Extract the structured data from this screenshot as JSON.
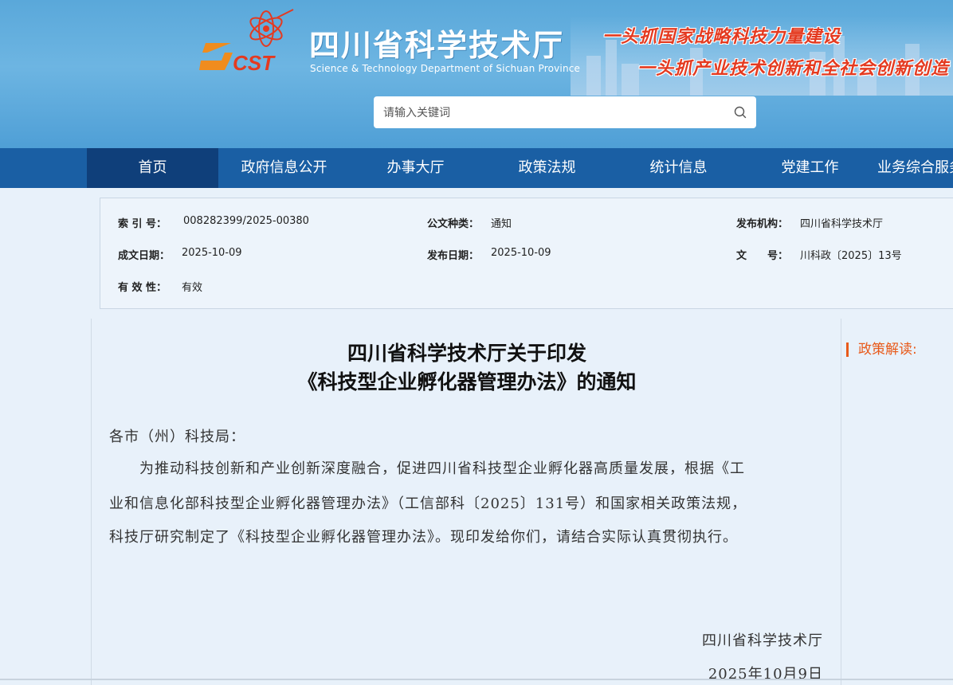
{
  "header": {
    "site_title": "四川省科学技术厅",
    "site_subtitle": "Science & Technology Department of Sichuan Province",
    "logo_text": "SCST",
    "slogan_line1": "一头抓国家战略科技力量建设",
    "slogan_line2": "一头抓产业技术创新和全社会创新创造",
    "search_placeholder": "请输入关键词"
  },
  "nav": {
    "items": [
      "首页",
      "政府信息公开",
      "办事大厅",
      "政策法规",
      "统计信息",
      "党建工作",
      "业务综合服务"
    ],
    "active_index": 0
  },
  "meta": {
    "index_label": "索 引 号：",
    "index_value": "008282399/2025-00380",
    "doc_type_label": "公文种类：",
    "doc_type_value": "通知",
    "publisher_label": "发布机构：",
    "publisher_value": "四川省科学技术厅",
    "written_date_label": "成文日期：",
    "written_date_value": "2025-10-09",
    "publish_date_label": "发布日期：",
    "publish_date_value": "2025-10-09",
    "doc_no_label": "文　　号：",
    "doc_no_value": "川科政〔2025〕13号",
    "validity_label": "有 效 性：",
    "validity_value": "有效"
  },
  "article": {
    "title_line1": "四川省科学技术厅关于印发",
    "title_line2": "《科技型企业孵化器管理办法》的通知",
    "salutation": "各市（州）科技局：",
    "body_line1": "　　为推动科技创新和产业创新深度融合，促进四川省科技型企业孵化器高质量发展，根据《工",
    "body_line2": "业和信息化部科技型企业孵化器管理办法》（工信部科〔2025〕131号）和国家相关政策法规，",
    "body_line3": "科技厅研究制定了《科技型企业孵化器管理办法》。现印发给你们，请结合实际认真贯彻执行。",
    "signature": "四川省科学技术厅",
    "date": "2025年10月9日"
  },
  "sidebar": {
    "heading": "政策解读:"
  },
  "colors": {
    "nav_bg": "#1a5fa4",
    "nav_active": "#0f3f7a",
    "accent_orange": "#e85a1a",
    "slogan_red": "#e43a20"
  }
}
